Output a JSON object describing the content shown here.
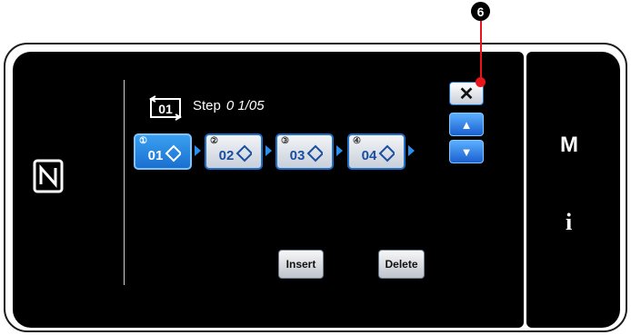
{
  "callout": {
    "number": "6"
  },
  "step": {
    "label": "Step",
    "count": "0 1/05"
  },
  "steps": [
    {
      "num": "①",
      "code": "01"
    },
    {
      "num": "②",
      "code": "02"
    },
    {
      "num": "③",
      "code": "03"
    },
    {
      "num": "④",
      "code": "04"
    }
  ],
  "buttons": {
    "close": "✕",
    "up": "▲",
    "down": "▼",
    "insert": "Insert",
    "delete": "Delete"
  },
  "side": {
    "m_label": "M",
    "info_label": "i"
  },
  "colors": {
    "accent": "#1a6fd0",
    "callout": "#e8161b"
  },
  "icons": {
    "nfc": "nfc-icon",
    "step": "step-repeat-icon"
  }
}
